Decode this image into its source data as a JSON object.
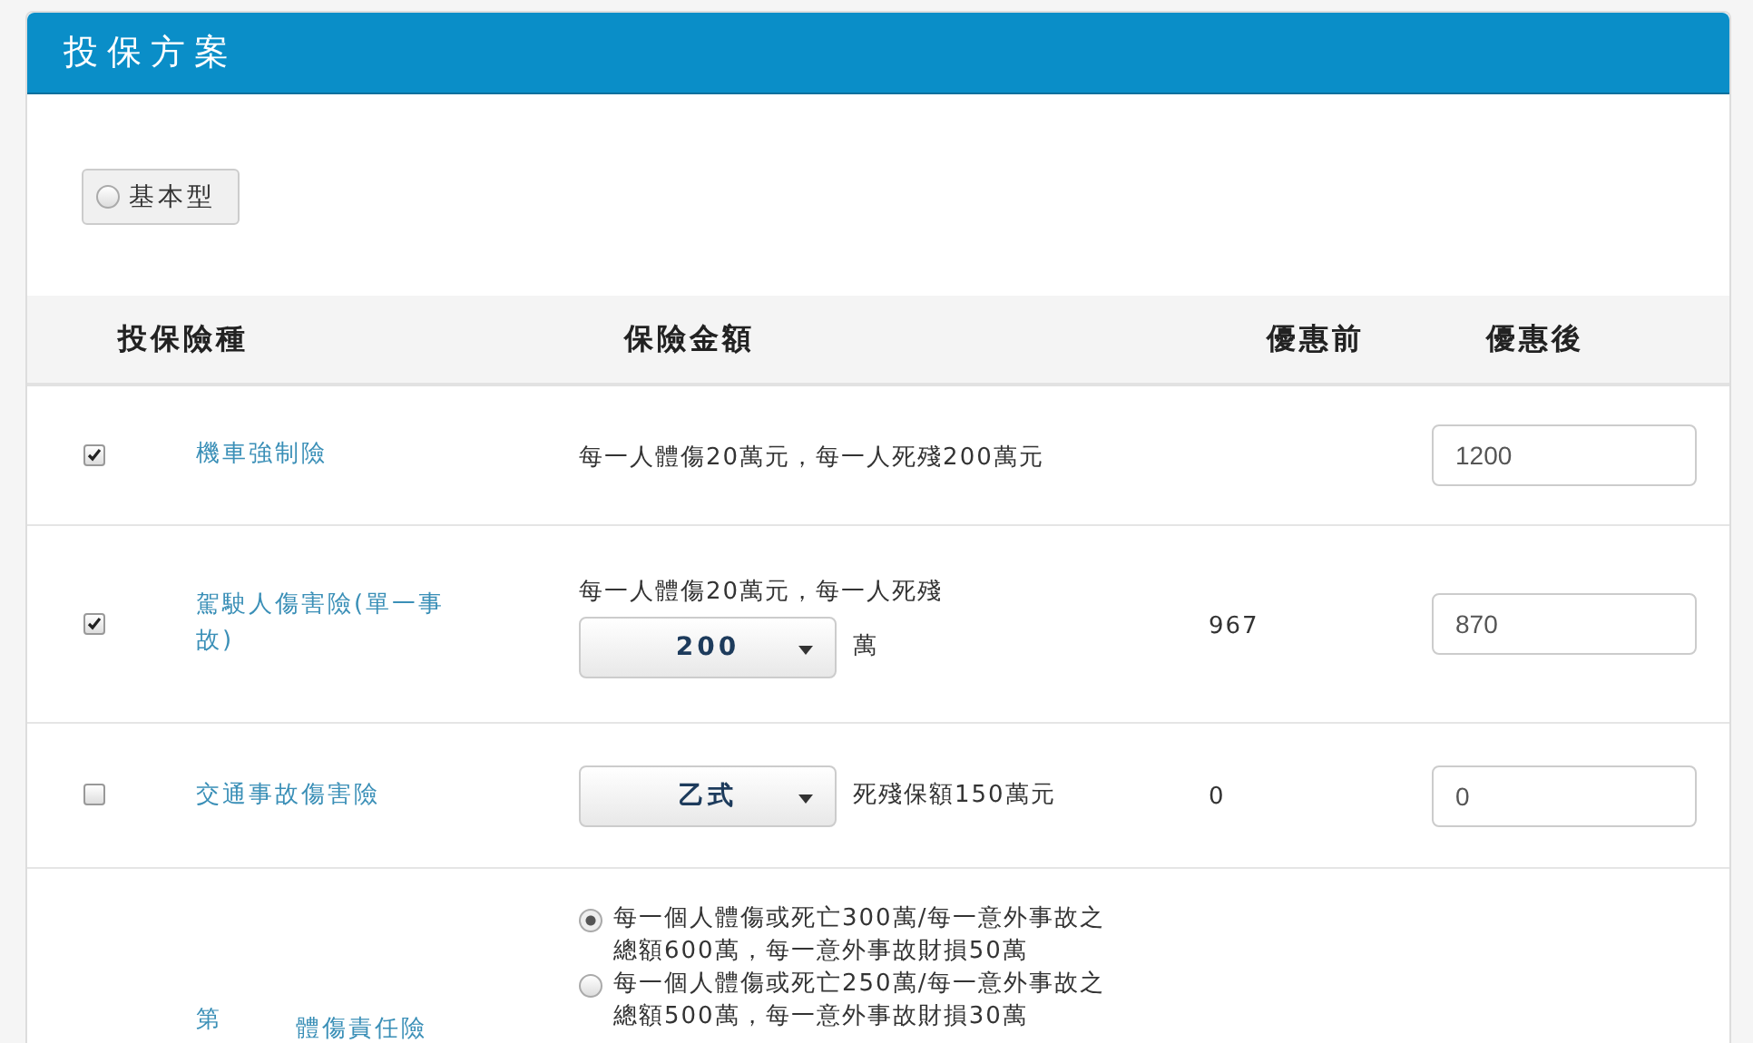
{
  "panel": {
    "title": "投保方案"
  },
  "plan_button": {
    "label": "基本型",
    "selected": false
  },
  "table": {
    "columns": [
      "投保險種",
      "保險金額",
      "優惠前",
      "優惠後"
    ],
    "rows": [
      {
        "checked": true,
        "name": [
          "機車強制險"
        ],
        "amount": {
          "kind": "text",
          "text": "每一人體傷20萬元，每一人死殘200萬元"
        },
        "after": "1200"
      },
      {
        "checked": true,
        "name": [
          "駕駛人傷害險(單一事故)"
        ],
        "amount": {
          "kind": "select_text",
          "prefix": "每一人體傷20萬元，每一人死殘",
          "select": "200",
          "suffix": "萬"
        },
        "before": "967",
        "after": "870"
      },
      {
        "checked": false,
        "name": [
          "交通事故傷害險"
        ],
        "amount": {
          "kind": "select",
          "select": "乙式",
          "suffix": "死殘保額150萬元"
        },
        "before": "0",
        "after": "0"
      },
      {
        "name": [
          "第",
          "體傷責任險"
        ],
        "amount": {
          "kind": "radios",
          "options": [
            {
              "label": "每一個人體傷或死亡300萬/每一意外事故之總額600萬，每一意外事故財損50萬",
              "selected": true
            },
            {
              "label": "每一個人體傷或死亡250萬/每一意外事故之總額500萬，每一意外事故財損30萬",
              "selected": false
            }
          ]
        }
      }
    ]
  }
}
